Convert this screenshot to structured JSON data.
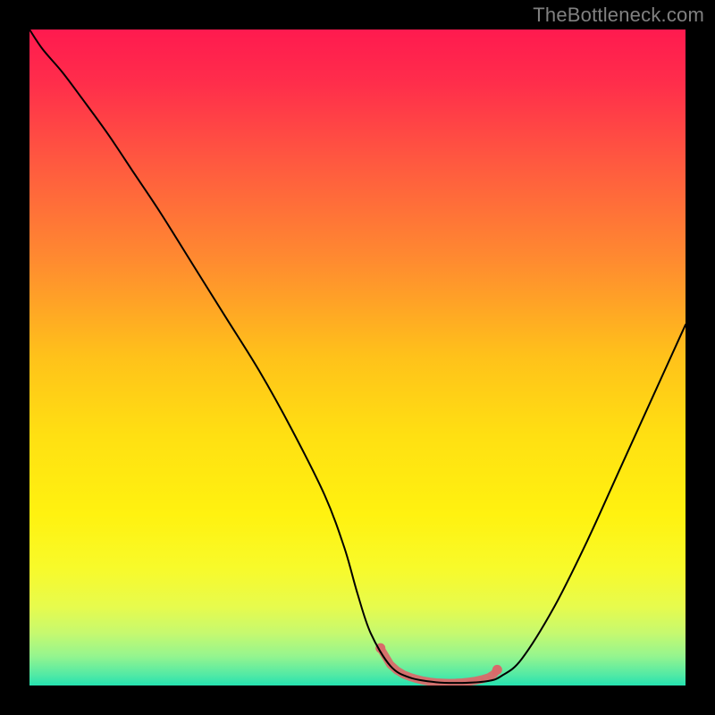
{
  "watermark": "TheBottleneck.com",
  "chart_data": {
    "type": "line",
    "title": "",
    "xlabel": "",
    "ylabel": "",
    "xlim": [
      0,
      100
    ],
    "ylim": [
      0,
      100
    ],
    "grid": false,
    "legend": false,
    "background_gradient_stops": [
      {
        "offset": 0.0,
        "color": "#ff1a4f"
      },
      {
        "offset": 0.08,
        "color": "#ff2d4b"
      },
      {
        "offset": 0.2,
        "color": "#ff5840"
      },
      {
        "offset": 0.35,
        "color": "#ff8a30"
      },
      {
        "offset": 0.5,
        "color": "#ffc21a"
      },
      {
        "offset": 0.62,
        "color": "#ffe012"
      },
      {
        "offset": 0.74,
        "color": "#fff210"
      },
      {
        "offset": 0.82,
        "color": "#f8fa2a"
      },
      {
        "offset": 0.88,
        "color": "#e7fb4d"
      },
      {
        "offset": 0.92,
        "color": "#c6f96f"
      },
      {
        "offset": 0.955,
        "color": "#95f58e"
      },
      {
        "offset": 0.985,
        "color": "#4fe9a6"
      },
      {
        "offset": 1.0,
        "color": "#25e2b0"
      }
    ],
    "series": [
      {
        "name": "bottleneck-curve",
        "color": "#000000",
        "stroke_width": 2,
        "x": [
          0.0,
          2.0,
          5.0,
          8.0,
          12.0,
          16.0,
          20.0,
          25.0,
          30.0,
          35.0,
          40.0,
          45.0,
          48.0,
          50.0,
          52.0,
          55.0,
          58.0,
          62.0,
          66.0,
          70.0,
          72.0,
          75.0,
          80.0,
          85.0,
          90.0,
          95.0,
          100.0
        ],
        "y": [
          100.0,
          97.0,
          93.5,
          89.5,
          84.0,
          78.0,
          72.0,
          64.0,
          56.0,
          48.0,
          39.0,
          29.0,
          21.0,
          14.0,
          8.0,
          3.0,
          1.2,
          0.5,
          0.4,
          0.7,
          1.5,
          4.0,
          12.0,
          22.0,
          33.0,
          44.0,
          55.0
        ]
      }
    ],
    "annotations": [
      {
        "name": "valley-marker",
        "type": "dot-band",
        "color": "#d96a6a",
        "dot_radius": 1.6,
        "stroke_width": 9,
        "x": [
          53.5,
          55.0,
          56.0,
          57.0,
          58.0,
          59.0,
          60.0,
          61.0,
          62.0,
          63.0,
          64.0,
          65.0,
          66.0,
          67.0,
          68.0,
          69.0,
          70.0,
          70.8,
          71.3
        ],
        "y": [
          5.7,
          3.2,
          2.3,
          1.7,
          1.3,
          1.0,
          0.75,
          0.58,
          0.48,
          0.43,
          0.4,
          0.42,
          0.48,
          0.58,
          0.73,
          0.95,
          1.25,
          1.75,
          2.4
        ]
      }
    ]
  }
}
